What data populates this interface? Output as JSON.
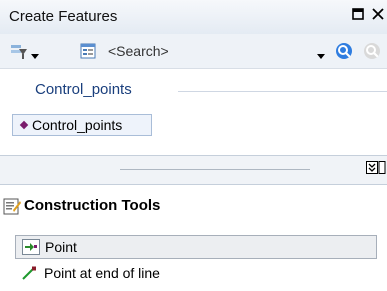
{
  "window": {
    "title": "Create Features",
    "pin_icon": "pin-box-icon",
    "close_icon": "close-icon"
  },
  "toolbar": {
    "search_placeholder": "<Search>",
    "icons": [
      "organize-templates-icon",
      "dropdown-arrow-icon",
      "view-options-icon",
      "search-dropdown-icon",
      "search-icon",
      "clear-search-icon"
    ]
  },
  "templates": {
    "group_label": "Control_points",
    "items": [
      {
        "label": "Control_points",
        "symbol_color": "#7a1c6d"
      }
    ]
  },
  "construction_tools": {
    "header": "Construction Tools",
    "items": [
      {
        "label": "Point",
        "selected": true,
        "icon": "point-tool-icon"
      },
      {
        "label": "Point at end of line",
        "selected": false,
        "icon": "point-at-end-of-line-icon"
      }
    ]
  },
  "colors": {
    "group_header": "#1a3f7d",
    "selection_bg": "#eef3fb",
    "accent": "#1f6fd8"
  }
}
